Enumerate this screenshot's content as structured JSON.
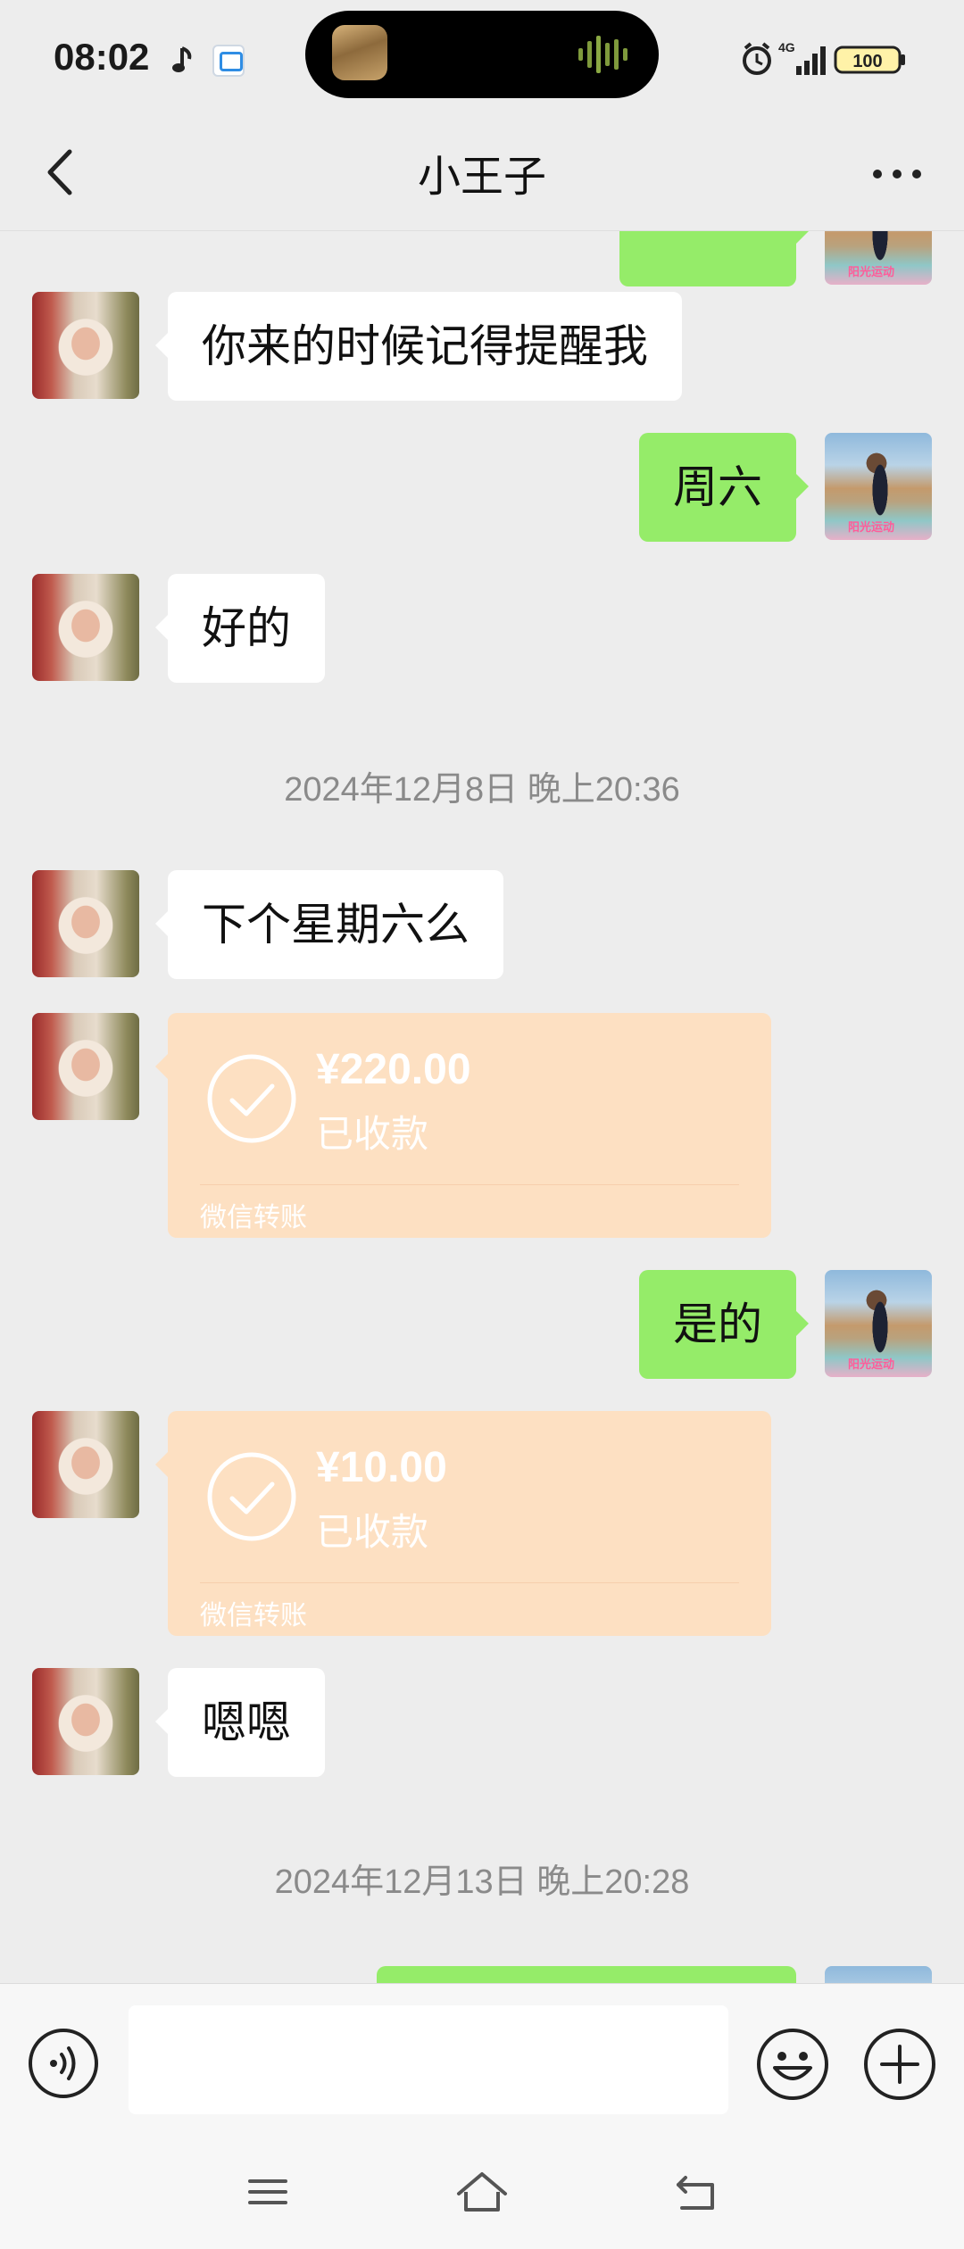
{
  "status_bar": {
    "time": "08:02",
    "network": "4G",
    "battery": "100",
    "icons": [
      "music-note-icon",
      "app-notification-icon",
      "alarm-icon",
      "signal-icon",
      "battery-icon"
    ]
  },
  "header": {
    "title": "小王子",
    "back_icon": "chevron-left-icon",
    "more_icon": "more-dots-icon"
  },
  "messages": [
    {
      "kind": "text",
      "side": "right",
      "text": ""
    },
    {
      "kind": "text",
      "side": "left",
      "text": "你来的时候记得提醒我"
    },
    {
      "kind": "text",
      "side": "right",
      "text": "周六"
    },
    {
      "kind": "text",
      "side": "left",
      "text": "好的"
    },
    {
      "kind": "timestamp",
      "text": "2024年12月8日 晚上20:36"
    },
    {
      "kind": "text",
      "side": "left",
      "text": "下个星期六么"
    },
    {
      "kind": "transfer",
      "side": "left",
      "amount": "¥220.00",
      "status": "已收款",
      "label": "微信转账"
    },
    {
      "kind": "text",
      "side": "right",
      "text": "是的"
    },
    {
      "kind": "transfer",
      "side": "left",
      "amount": "¥10.00",
      "status": "已收款",
      "label": "微信转账"
    },
    {
      "kind": "text",
      "side": "left",
      "text": "嗯嗯"
    },
    {
      "kind": "timestamp",
      "text": "2024年12月13日 晚上20:28"
    },
    {
      "kind": "text",
      "side": "right",
      "text": ""
    }
  ],
  "input_bar": {
    "value": "",
    "voice_icon": "voice-icon",
    "emoji_icon": "emoji-icon",
    "plus_icon": "plus-icon"
  },
  "colors": {
    "background": "#ededed",
    "self_bubble": "#95ec69",
    "other_bubble": "#ffffff",
    "transfer_card": "#fde0c2",
    "timestamp_text": "#8a8a8a"
  }
}
